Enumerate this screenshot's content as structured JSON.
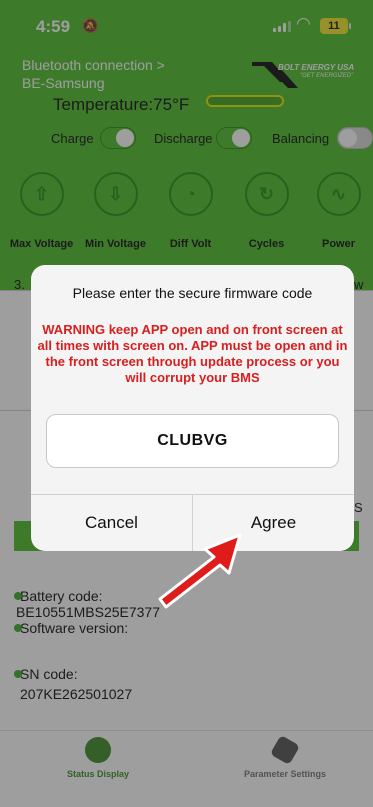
{
  "status_bar": {
    "time": "4:59",
    "battery": "11"
  },
  "header": {
    "connection": "Bluetooth connection >",
    "device": "BE-Samsung",
    "brand_name": "BOLT ENERGY USA",
    "brand_tagline": "\"GET ENERGIZED\""
  },
  "temperature": {
    "label": "Temperature:75°F"
  },
  "toggles": [
    {
      "label": "Charge",
      "state": "on"
    },
    {
      "label": "Discharge",
      "state": "on"
    },
    {
      "label": "Balancing",
      "state": "off"
    }
  ],
  "metrics": [
    {
      "label": "Max Voltage",
      "icon": "battery-up-icon"
    },
    {
      "label": "Min Voltage",
      "icon": "battery-down-icon"
    },
    {
      "label": "Diff Volt",
      "icon": "gauge-icon"
    },
    {
      "label": "Cycles",
      "icon": "cycle-bolt-icon"
    },
    {
      "label": "Power",
      "icon": "pulse-icon"
    }
  ],
  "peek": {
    "left": "3.",
    "right": "w",
    "right_mid": "S"
  },
  "info": {
    "battery_code_label": "Battery code:",
    "battery_code_value": "BE10551MBS25E7377",
    "software_label": "Software version:",
    "sn_label": "SN code:",
    "sn_value": "207KE262501027"
  },
  "bottom_nav": [
    {
      "label": "Status Display",
      "icon": "status-display-icon",
      "active": true
    },
    {
      "label": "Parameter Settings",
      "icon": "parameter-settings-icon",
      "active": false
    }
  ],
  "dialog": {
    "title": "Please enter the secure firmware code",
    "warning": "WARNING keep APP open and on front screen at all times with screen on. APP must be open and in the front screen through update process or you will corrupt your BMS",
    "code_value": "CLUBVG",
    "cancel_label": "Cancel",
    "agree_label": "Agree"
  },
  "colors": {
    "accent_green": "#4fbf2f",
    "warning_red": "#d81e1e",
    "arrow_red": "#e01b1b"
  }
}
